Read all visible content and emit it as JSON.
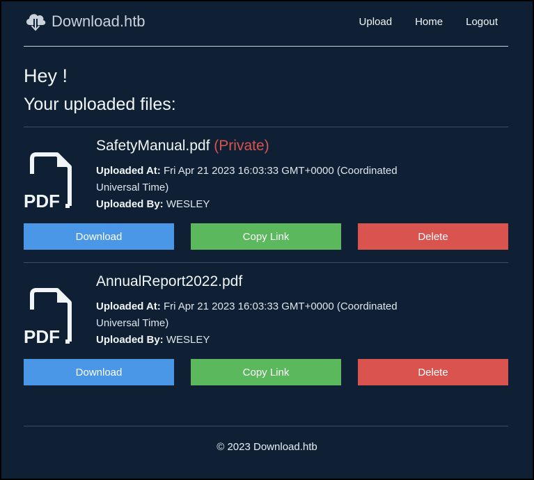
{
  "header": {
    "brand_icon": "cloud-download-icon",
    "brand": "Download.htb",
    "nav": [
      "Upload",
      "Home",
      "Logout"
    ]
  },
  "main": {
    "greeting": "Hey !",
    "subhead": "Your uploaded files:",
    "files": [
      {
        "name": "SafetyManual.pdf",
        "tag": "(Private)",
        "uploaded_at_label": "Uploaded At:",
        "uploaded_at": "Fri Apr 21 2023 16:03:33 GMT+0000 (Coordinated Universal Time)",
        "uploaded_by_label": "Uploaded By:",
        "uploaded_by": "WESLEY",
        "buttons": {
          "download": "Download",
          "copy": "Copy Link",
          "delete": "Delete"
        }
      },
      {
        "name": "AnnualReport2022.pdf",
        "tag": "",
        "uploaded_at_label": "Uploaded At:",
        "uploaded_at": "Fri Apr 21 2023 16:03:33 GMT+0000 (Coordinated Universal Time)",
        "uploaded_by_label": "Uploaded By:",
        "uploaded_by": "WESLEY",
        "buttons": {
          "download": "Download",
          "copy": "Copy Link",
          "delete": "Delete"
        }
      }
    ]
  },
  "icons": {
    "file": "pdf-file-icon"
  },
  "footer": {
    "text": "© 2023 Download.htb"
  },
  "colors": {
    "background": "#0f2034",
    "download": "#4a97e8",
    "copy": "#5cb85c",
    "delete": "#d9534f"
  }
}
